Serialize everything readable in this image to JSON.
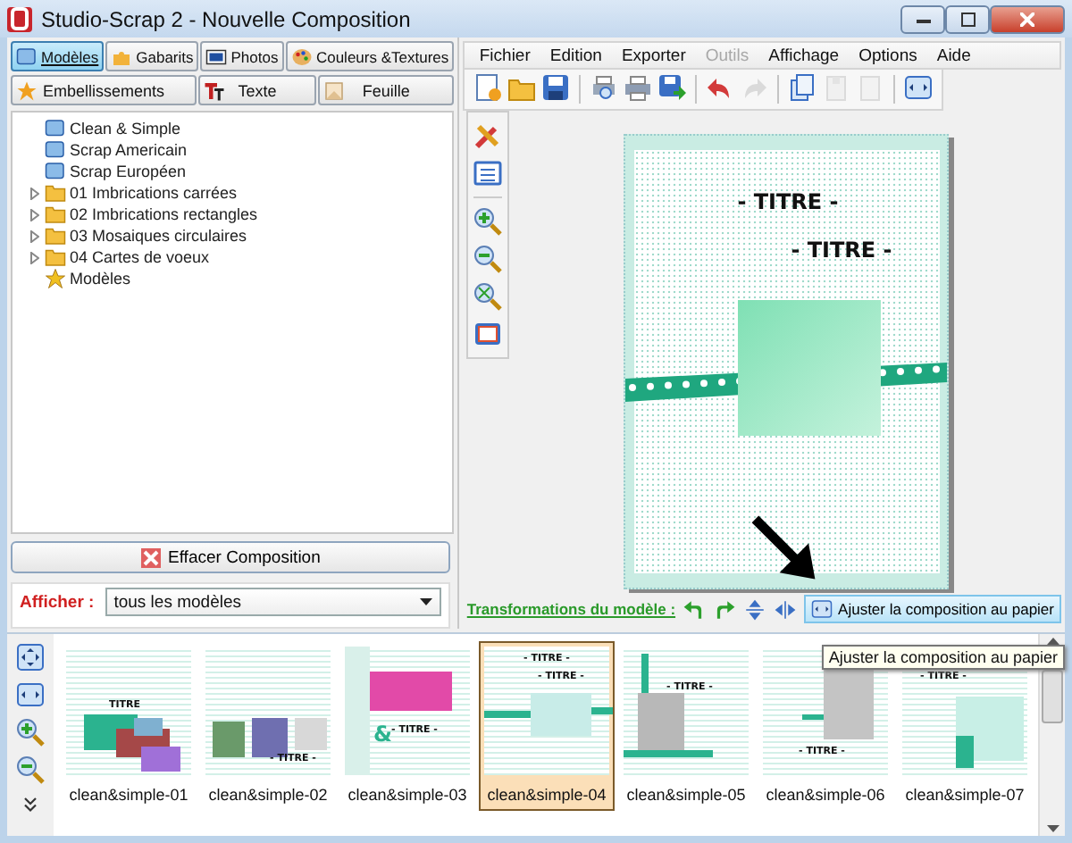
{
  "window": {
    "title": "Studio-Scrap 2 - Nouvelle Composition"
  },
  "tabs": [
    {
      "label": "Modèles",
      "selected": true
    },
    {
      "label": "Gabarits",
      "selected": false
    },
    {
      "label": "Photos",
      "selected": false
    },
    {
      "label": "Couleurs &Textures",
      "selected": false
    }
  ],
  "tabs_row2": [
    {
      "label": "Embellissements",
      "selected": false
    },
    {
      "label": "Texte",
      "selected": false
    },
    {
      "label": "Feuille",
      "selected": false
    }
  ],
  "tree": [
    {
      "label": "Clean & Simple",
      "kind": "model"
    },
    {
      "label": "Scrap Americain",
      "kind": "model"
    },
    {
      "label": "Scrap Européen",
      "kind": "model"
    },
    {
      "label": "01 Imbrications carrées",
      "kind": "folder",
      "expanded": false
    },
    {
      "label": "02 Imbrications rectangles",
      "kind": "folder",
      "expanded": false
    },
    {
      "label": "03 Mosaiques circulaires",
      "kind": "folder",
      "expanded": false
    },
    {
      "label": "04 Cartes de voeux",
      "kind": "folder",
      "expanded": false
    },
    {
      "label": "Modèles",
      "kind": "star"
    }
  ],
  "clear_button": "Effacer Composition",
  "filter": {
    "label": "Afficher :",
    "value": "tous les modèles"
  },
  "menu": [
    {
      "label": "Fichier",
      "disabled": false
    },
    {
      "label": "Edition",
      "disabled": false
    },
    {
      "label": "Exporter",
      "disabled": false
    },
    {
      "label": "Outils",
      "disabled": true
    },
    {
      "label": "Affichage",
      "disabled": false
    },
    {
      "label": "Options",
      "disabled": false
    },
    {
      "label": "Aide",
      "disabled": false
    }
  ],
  "toolbar": [
    {
      "disabled": false
    },
    {
      "disabled": false
    },
    {
      "disabled": false
    },
    {
      "disabled": false
    },
    {
      "disabled": false
    },
    {
      "disabled": false
    },
    {
      "disabled": false
    },
    {
      "disabled": true
    },
    {
      "disabled": false
    },
    {
      "disabled": true
    },
    {
      "disabled": true
    },
    {
      "disabled": false
    }
  ],
  "canvas": {
    "titles": [
      "- TITRE -",
      "- TITRE -"
    ]
  },
  "transform_bar": {
    "label": "Transformations du modèle :",
    "button": "Ajuster la composition au papier"
  },
  "thumbnails": [
    {
      "name": "clean&simple-01",
      "selected": false,
      "titles": [
        "TITRE"
      ]
    },
    {
      "name": "clean&simple-02",
      "selected": false,
      "titles": [
        "- TITRE -"
      ]
    },
    {
      "name": "clean&simple-03",
      "selected": false,
      "titles": [
        "&",
        "- TITRE -"
      ]
    },
    {
      "name": "clean&simple-04",
      "selected": true,
      "titles": [
        "- TITRE -",
        "- TITRE -"
      ]
    },
    {
      "name": "clean&simple-05",
      "selected": false,
      "titles": [
        "- TITRE -"
      ]
    },
    {
      "name": "clean&simple-06",
      "selected": false,
      "titles": [
        "- TITRE -"
      ]
    },
    {
      "name": "clean&simple-07",
      "selected": false,
      "titles": [
        "- TITRE -"
      ]
    }
  ],
  "tooltip": "Ajuster la composition au papier"
}
